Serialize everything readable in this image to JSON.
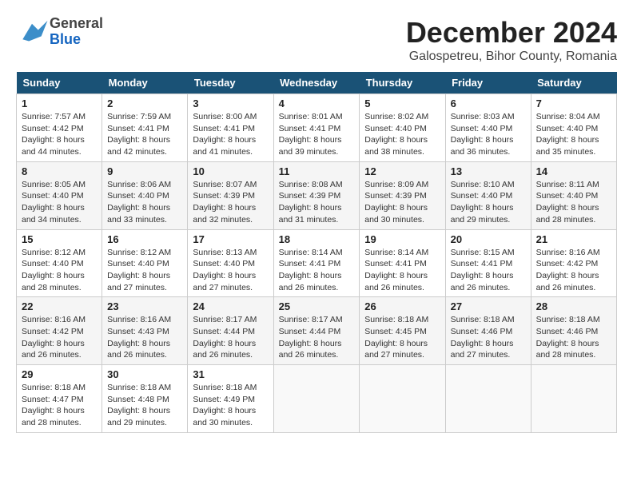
{
  "header": {
    "logo_general": "General",
    "logo_blue": "Blue",
    "month_title": "December 2024",
    "location": "Galospetreu, Bihor County, Romania"
  },
  "days_of_week": [
    "Sunday",
    "Monday",
    "Tuesday",
    "Wednesday",
    "Thursday",
    "Friday",
    "Saturday"
  ],
  "weeks": [
    [
      {
        "day": "1",
        "sunrise": "Sunrise: 7:57 AM",
        "sunset": "Sunset: 4:42 PM",
        "daylight": "Daylight: 8 hours and 44 minutes."
      },
      {
        "day": "2",
        "sunrise": "Sunrise: 7:59 AM",
        "sunset": "Sunset: 4:41 PM",
        "daylight": "Daylight: 8 hours and 42 minutes."
      },
      {
        "day": "3",
        "sunrise": "Sunrise: 8:00 AM",
        "sunset": "Sunset: 4:41 PM",
        "daylight": "Daylight: 8 hours and 41 minutes."
      },
      {
        "day": "4",
        "sunrise": "Sunrise: 8:01 AM",
        "sunset": "Sunset: 4:41 PM",
        "daylight": "Daylight: 8 hours and 39 minutes."
      },
      {
        "day": "5",
        "sunrise": "Sunrise: 8:02 AM",
        "sunset": "Sunset: 4:40 PM",
        "daylight": "Daylight: 8 hours and 38 minutes."
      },
      {
        "day": "6",
        "sunrise": "Sunrise: 8:03 AM",
        "sunset": "Sunset: 4:40 PM",
        "daylight": "Daylight: 8 hours and 36 minutes."
      },
      {
        "day": "7",
        "sunrise": "Sunrise: 8:04 AM",
        "sunset": "Sunset: 4:40 PM",
        "daylight": "Daylight: 8 hours and 35 minutes."
      }
    ],
    [
      {
        "day": "8",
        "sunrise": "Sunrise: 8:05 AM",
        "sunset": "Sunset: 4:40 PM",
        "daylight": "Daylight: 8 hours and 34 minutes."
      },
      {
        "day": "9",
        "sunrise": "Sunrise: 8:06 AM",
        "sunset": "Sunset: 4:40 PM",
        "daylight": "Daylight: 8 hours and 33 minutes."
      },
      {
        "day": "10",
        "sunrise": "Sunrise: 8:07 AM",
        "sunset": "Sunset: 4:39 PM",
        "daylight": "Daylight: 8 hours and 32 minutes."
      },
      {
        "day": "11",
        "sunrise": "Sunrise: 8:08 AM",
        "sunset": "Sunset: 4:39 PM",
        "daylight": "Daylight: 8 hours and 31 minutes."
      },
      {
        "day": "12",
        "sunrise": "Sunrise: 8:09 AM",
        "sunset": "Sunset: 4:39 PM",
        "daylight": "Daylight: 8 hours and 30 minutes."
      },
      {
        "day": "13",
        "sunrise": "Sunrise: 8:10 AM",
        "sunset": "Sunset: 4:40 PM",
        "daylight": "Daylight: 8 hours and 29 minutes."
      },
      {
        "day": "14",
        "sunrise": "Sunrise: 8:11 AM",
        "sunset": "Sunset: 4:40 PM",
        "daylight": "Daylight: 8 hours and 28 minutes."
      }
    ],
    [
      {
        "day": "15",
        "sunrise": "Sunrise: 8:12 AM",
        "sunset": "Sunset: 4:40 PM",
        "daylight": "Daylight: 8 hours and 28 minutes."
      },
      {
        "day": "16",
        "sunrise": "Sunrise: 8:12 AM",
        "sunset": "Sunset: 4:40 PM",
        "daylight": "Daylight: 8 hours and 27 minutes."
      },
      {
        "day": "17",
        "sunrise": "Sunrise: 8:13 AM",
        "sunset": "Sunset: 4:40 PM",
        "daylight": "Daylight: 8 hours and 27 minutes."
      },
      {
        "day": "18",
        "sunrise": "Sunrise: 8:14 AM",
        "sunset": "Sunset: 4:41 PM",
        "daylight": "Daylight: 8 hours and 26 minutes."
      },
      {
        "day": "19",
        "sunrise": "Sunrise: 8:14 AM",
        "sunset": "Sunset: 4:41 PM",
        "daylight": "Daylight: 8 hours and 26 minutes."
      },
      {
        "day": "20",
        "sunrise": "Sunrise: 8:15 AM",
        "sunset": "Sunset: 4:41 PM",
        "daylight": "Daylight: 8 hours and 26 minutes."
      },
      {
        "day": "21",
        "sunrise": "Sunrise: 8:16 AM",
        "sunset": "Sunset: 4:42 PM",
        "daylight": "Daylight: 8 hours and 26 minutes."
      }
    ],
    [
      {
        "day": "22",
        "sunrise": "Sunrise: 8:16 AM",
        "sunset": "Sunset: 4:42 PM",
        "daylight": "Daylight: 8 hours and 26 minutes."
      },
      {
        "day": "23",
        "sunrise": "Sunrise: 8:16 AM",
        "sunset": "Sunset: 4:43 PM",
        "daylight": "Daylight: 8 hours and 26 minutes."
      },
      {
        "day": "24",
        "sunrise": "Sunrise: 8:17 AM",
        "sunset": "Sunset: 4:44 PM",
        "daylight": "Daylight: 8 hours and 26 minutes."
      },
      {
        "day": "25",
        "sunrise": "Sunrise: 8:17 AM",
        "sunset": "Sunset: 4:44 PM",
        "daylight": "Daylight: 8 hours and 26 minutes."
      },
      {
        "day": "26",
        "sunrise": "Sunrise: 8:18 AM",
        "sunset": "Sunset: 4:45 PM",
        "daylight": "Daylight: 8 hours and 27 minutes."
      },
      {
        "day": "27",
        "sunrise": "Sunrise: 8:18 AM",
        "sunset": "Sunset: 4:46 PM",
        "daylight": "Daylight: 8 hours and 27 minutes."
      },
      {
        "day": "28",
        "sunrise": "Sunrise: 8:18 AM",
        "sunset": "Sunset: 4:46 PM",
        "daylight": "Daylight: 8 hours and 28 minutes."
      }
    ],
    [
      {
        "day": "29",
        "sunrise": "Sunrise: 8:18 AM",
        "sunset": "Sunset: 4:47 PM",
        "daylight": "Daylight: 8 hours and 28 minutes."
      },
      {
        "day": "30",
        "sunrise": "Sunrise: 8:18 AM",
        "sunset": "Sunset: 4:48 PM",
        "daylight": "Daylight: 8 hours and 29 minutes."
      },
      {
        "day": "31",
        "sunrise": "Sunrise: 8:18 AM",
        "sunset": "Sunset: 4:49 PM",
        "daylight": "Daylight: 8 hours and 30 minutes."
      },
      null,
      null,
      null,
      null
    ]
  ]
}
